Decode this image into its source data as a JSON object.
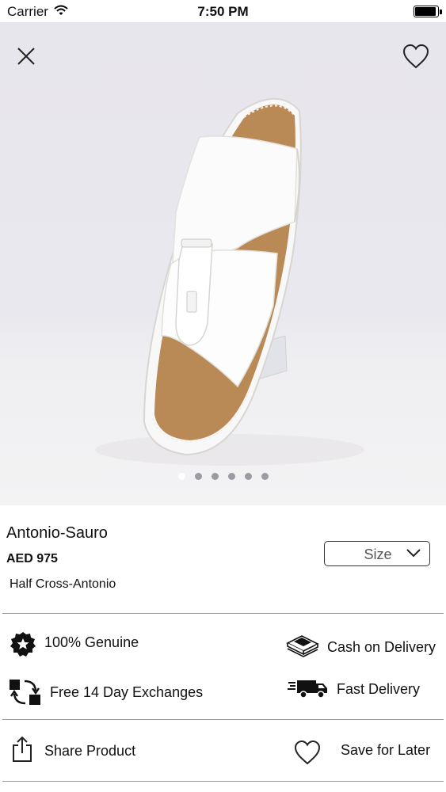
{
  "status_bar": {
    "carrier": "Carrier",
    "time": "7:50 PM"
  },
  "gallery": {
    "image_count": 6,
    "active_index": 0
  },
  "product": {
    "name": "Antonio-Sauro",
    "price": "AED 975",
    "subtitle": "Half Cross-Antonio"
  },
  "size_selector": {
    "label": "Size"
  },
  "features": {
    "genuine": "100% Genuine",
    "cash_on_delivery": "Cash on Delivery",
    "exchanges": "Free 14 Day Exchanges",
    "fast_delivery": "Fast Delivery"
  },
  "actions": {
    "share": "Share Product",
    "save": "Save for Later"
  },
  "icons": {
    "close": "close-icon",
    "favorite": "heart-icon",
    "genuine": "badge-star-icon",
    "cash": "cash-stack-icon",
    "exchange": "exchange-arrows-icon",
    "truck": "delivery-truck-icon",
    "share": "share-icon",
    "save": "heart-icon"
  }
}
